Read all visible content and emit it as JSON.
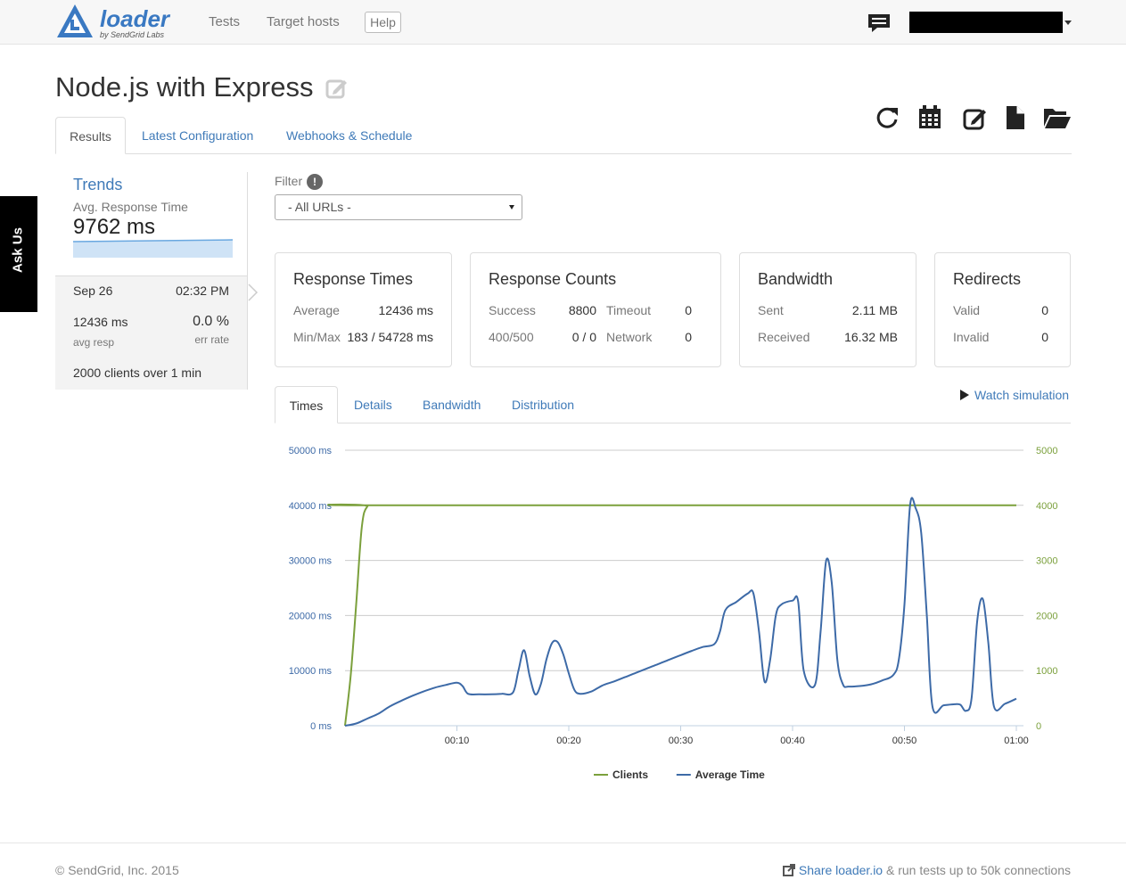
{
  "brand": {
    "name": "loader",
    "tagline": "by SendGrid Labs",
    "color": "#3a79c2"
  },
  "nav": {
    "tests": "Tests",
    "target_hosts": "Target hosts",
    "help": "Help"
  },
  "ask_us": "Ask Us",
  "page": {
    "title": "Node.js with Express"
  },
  "tabs": {
    "results": "Results",
    "latest_configuration": "Latest Configuration",
    "webhooks_schedule": "Webhooks & Schedule"
  },
  "trends": {
    "title": "Trends",
    "metric_label": "Avg. Response Time",
    "metric_value": "9762 ms",
    "run": {
      "date": "Sep 26",
      "time": "02:32 PM",
      "avg_resp_value": "12436 ms",
      "avg_resp_label": "avg resp",
      "err_rate_value": "0.0 %",
      "err_rate_label": "err rate",
      "clients_text": "2000 clients over",
      "duration_value": "1",
      "duration_unit": "min"
    }
  },
  "filter": {
    "label": "Filter",
    "info_icon": "!",
    "selected": "- All URLs -"
  },
  "cards": {
    "response_times": {
      "title": "Response Times",
      "average_label": "Average",
      "average_value": "12436 ms",
      "minmax_label": "Min/Max",
      "minmax_value": "183 / 54728 ms"
    },
    "response_counts": {
      "title": "Response Counts",
      "success_label": "Success",
      "success_value": "8800",
      "timeout_label": "Timeout",
      "timeout_value": "0",
      "http_label": "400/500",
      "http_value": "0 / 0",
      "network_label": "Network",
      "network_value": "0"
    },
    "bandwidth": {
      "title": "Bandwidth",
      "sent_label": "Sent",
      "sent_value": "2.11 MB",
      "received_label": "Received",
      "received_value": "16.32 MB"
    },
    "redirects": {
      "title": "Redirects",
      "valid_label": "Valid",
      "valid_value": "0",
      "invalid_label": "Invalid",
      "invalid_value": "0"
    }
  },
  "subtabs": {
    "times": "Times",
    "details": "Details",
    "bandwidth": "Bandwidth",
    "distribution": "Distribution"
  },
  "watch_simulation": "Watch simulation",
  "chart_data": {
    "type": "line",
    "title": "",
    "xlabel": "",
    "ylabel_left": "",
    "ylabel_right": "",
    "x_ticks": [
      "00:10",
      "00:20",
      "00:30",
      "00:40",
      "00:50",
      "01:00"
    ],
    "x_tick_values": [
      10,
      20,
      30,
      40,
      50,
      60
    ],
    "xlim": [
      0,
      60
    ],
    "y_left_ticks": [
      "0 ms",
      "10000 ms",
      "20000 ms",
      "30000 ms",
      "40000 ms",
      "50000 ms"
    ],
    "y_left_tick_values": [
      0,
      10000,
      20000,
      30000,
      40000,
      50000
    ],
    "ylim_left": [
      0,
      50000
    ],
    "y_right_ticks": [
      "0",
      "1000",
      "2000",
      "3000",
      "4000",
      "5000"
    ],
    "y_right_tick_values": [
      0,
      1000,
      2000,
      3000,
      4000,
      5000
    ],
    "ylim_right": [
      0,
      5000
    ],
    "grid": true,
    "legend_position": "bottom",
    "series": [
      {
        "name": "Clients",
        "axis": "right",
        "color": "#7ba03c",
        "points": [
          [
            0,
            0
          ],
          [
            0.5,
            900
          ],
          [
            1,
            2200
          ],
          [
            1.5,
            3600
          ],
          [
            2,
            3980
          ],
          [
            3,
            4000
          ],
          [
            60,
            4000
          ]
        ]
      },
      {
        "name": "Average Time",
        "axis": "left",
        "color": "#3d6aa7",
        "points": [
          [
            0,
            0
          ],
          [
            1,
            400
          ],
          [
            2,
            1300
          ],
          [
            3,
            2200
          ],
          [
            4,
            3500
          ],
          [
            5,
            4500
          ],
          [
            6,
            5400
          ],
          [
            7,
            6200
          ],
          [
            8,
            6900
          ],
          [
            9,
            7400
          ],
          [
            10,
            7800
          ],
          [
            10.5,
            7200
          ],
          [
            11,
            5800
          ],
          [
            12,
            5700
          ],
          [
            13,
            5700
          ],
          [
            14,
            5800
          ],
          [
            15,
            6000
          ],
          [
            15.5,
            10000
          ],
          [
            16,
            13700
          ],
          [
            16.5,
            9000
          ],
          [
            17,
            5700
          ],
          [
            17.5,
            7500
          ],
          [
            18,
            12000
          ],
          [
            18.5,
            15000
          ],
          [
            19,
            15200
          ],
          [
            19.5,
            13000
          ],
          [
            20,
            9500
          ],
          [
            20.5,
            6500
          ],
          [
            21,
            5800
          ],
          [
            22,
            6200
          ],
          [
            23,
            7300
          ],
          [
            24,
            8000
          ],
          [
            25,
            8800
          ],
          [
            26,
            9600
          ],
          [
            27,
            10400
          ],
          [
            28,
            11200
          ],
          [
            29,
            12000
          ],
          [
            30,
            12800
          ],
          [
            31,
            13600
          ],
          [
            32,
            14300
          ],
          [
            33,
            14800
          ],
          [
            33.5,
            17000
          ],
          [
            34,
            21000
          ],
          [
            35,
            22500
          ],
          [
            36,
            24000
          ],
          [
            36.5,
            24000
          ],
          [
            37,
            17000
          ],
          [
            37.5,
            8000
          ],
          [
            38,
            12000
          ],
          [
            38.5,
            20000
          ],
          [
            39,
            22000
          ],
          [
            40,
            22700
          ],
          [
            40.5,
            22500
          ],
          [
            41,
            10000
          ],
          [
            42,
            7400
          ],
          [
            42.5,
            17000
          ],
          [
            43,
            29900
          ],
          [
            43.5,
            26000
          ],
          [
            44,
            12000
          ],
          [
            44.5,
            7500
          ],
          [
            45,
            7100
          ],
          [
            46,
            7200
          ],
          [
            47,
            7500
          ],
          [
            48,
            8200
          ],
          [
            49,
            9200
          ],
          [
            49.5,
            12000
          ],
          [
            50,
            22000
          ],
          [
            50.5,
            40000
          ],
          [
            51,
            39500
          ],
          [
            51.5,
            35000
          ],
          [
            52,
            20000
          ],
          [
            52.5,
            3500
          ],
          [
            53.5,
            3700
          ],
          [
            54.5,
            3900
          ],
          [
            55,
            3800
          ],
          [
            55.5,
            2700
          ],
          [
            56,
            5000
          ],
          [
            56.5,
            19000
          ],
          [
            57,
            23000
          ],
          [
            57.5,
            15000
          ],
          [
            58,
            3500
          ],
          [
            59,
            4000
          ],
          [
            60,
            4900
          ]
        ]
      }
    ]
  },
  "footer": {
    "copyright": "© SendGrid, Inc. 2015",
    "share_link": "Share loader.io",
    "share_suffix": " & run tests up to 50k connections"
  }
}
